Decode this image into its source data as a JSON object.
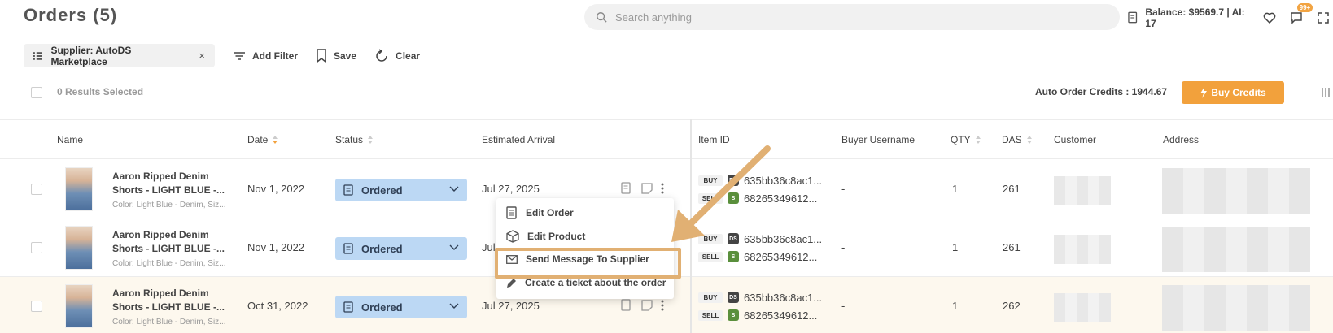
{
  "page": {
    "title": "Orders (5)"
  },
  "search": {
    "placeholder": "Search anything"
  },
  "top_bar": {
    "balance": "Balance: $9569.7 | AI: 17",
    "notification_badge": "99+"
  },
  "filters": {
    "chip_label": "Supplier: AutoDS Marketplace",
    "chip_remove": "×",
    "add_filter": "Add Filter",
    "save": "Save",
    "clear": "Clear"
  },
  "selection": {
    "results_selected": "0 Results Selected",
    "auto_order_credits": "Auto Order Credits : 1944.67",
    "buy_credits": "Buy Credits"
  },
  "columns": {
    "name": "Name",
    "date": "Date",
    "status": "Status",
    "estimated_arrival": "Estimated Arrival",
    "item_id": "Item ID",
    "buyer_username": "Buyer Username",
    "qty": "QTY",
    "das": "DAS",
    "customer": "Customer",
    "address": "Address"
  },
  "rows": [
    {
      "name": "Aaron Ripped Denim Shorts - LIGHT BLUE -...",
      "variant": "Color: Light Blue - Denim, Siz...",
      "date": "Nov 1, 2022",
      "status": "Ordered",
      "arrival": "Jul 27, 2025",
      "buy_tag": "BUY",
      "sell_tag": "SELL",
      "buy_id": "635bb36c8ac1...",
      "sell_id": "68265349612...",
      "buyer": "-",
      "qty": "1",
      "das": "261"
    },
    {
      "name": "Aaron Ripped Denim Shorts - LIGHT BLUE -...",
      "variant": "Color: Light Blue - Denim, Siz...",
      "date": "Nov 1, 2022",
      "status": "Ordered",
      "arrival": "Jul",
      "buy_tag": "BUY",
      "sell_tag": "SELL",
      "buy_id": "635bb36c8ac1...",
      "sell_id": "68265349612...",
      "buyer": "-",
      "qty": "1",
      "das": "261"
    },
    {
      "name": "Aaron Ripped Denim Shorts - LIGHT BLUE -...",
      "variant": "Color: Light Blue - Denim, Siz...",
      "date": "Oct 31, 2022",
      "status": "Ordered",
      "arrival": "Jul 27, 2025",
      "buy_tag": "BUY",
      "sell_tag": "SELL",
      "buy_id": "635bb36c8ac1...",
      "sell_id": "68265349612...",
      "buyer": "-",
      "qty": "1",
      "das": "262"
    }
  ],
  "context_menu": {
    "edit_order": "Edit Order",
    "edit_product": "Edit Product",
    "send_message": "Send Message To Supplier",
    "create_ticket": "Create a ticket about the order"
  },
  "store_badge": "DS",
  "colors": {
    "accent": "#f2a13c",
    "status_bg": "#bcd8f4",
    "highlight": "#e1b073"
  }
}
